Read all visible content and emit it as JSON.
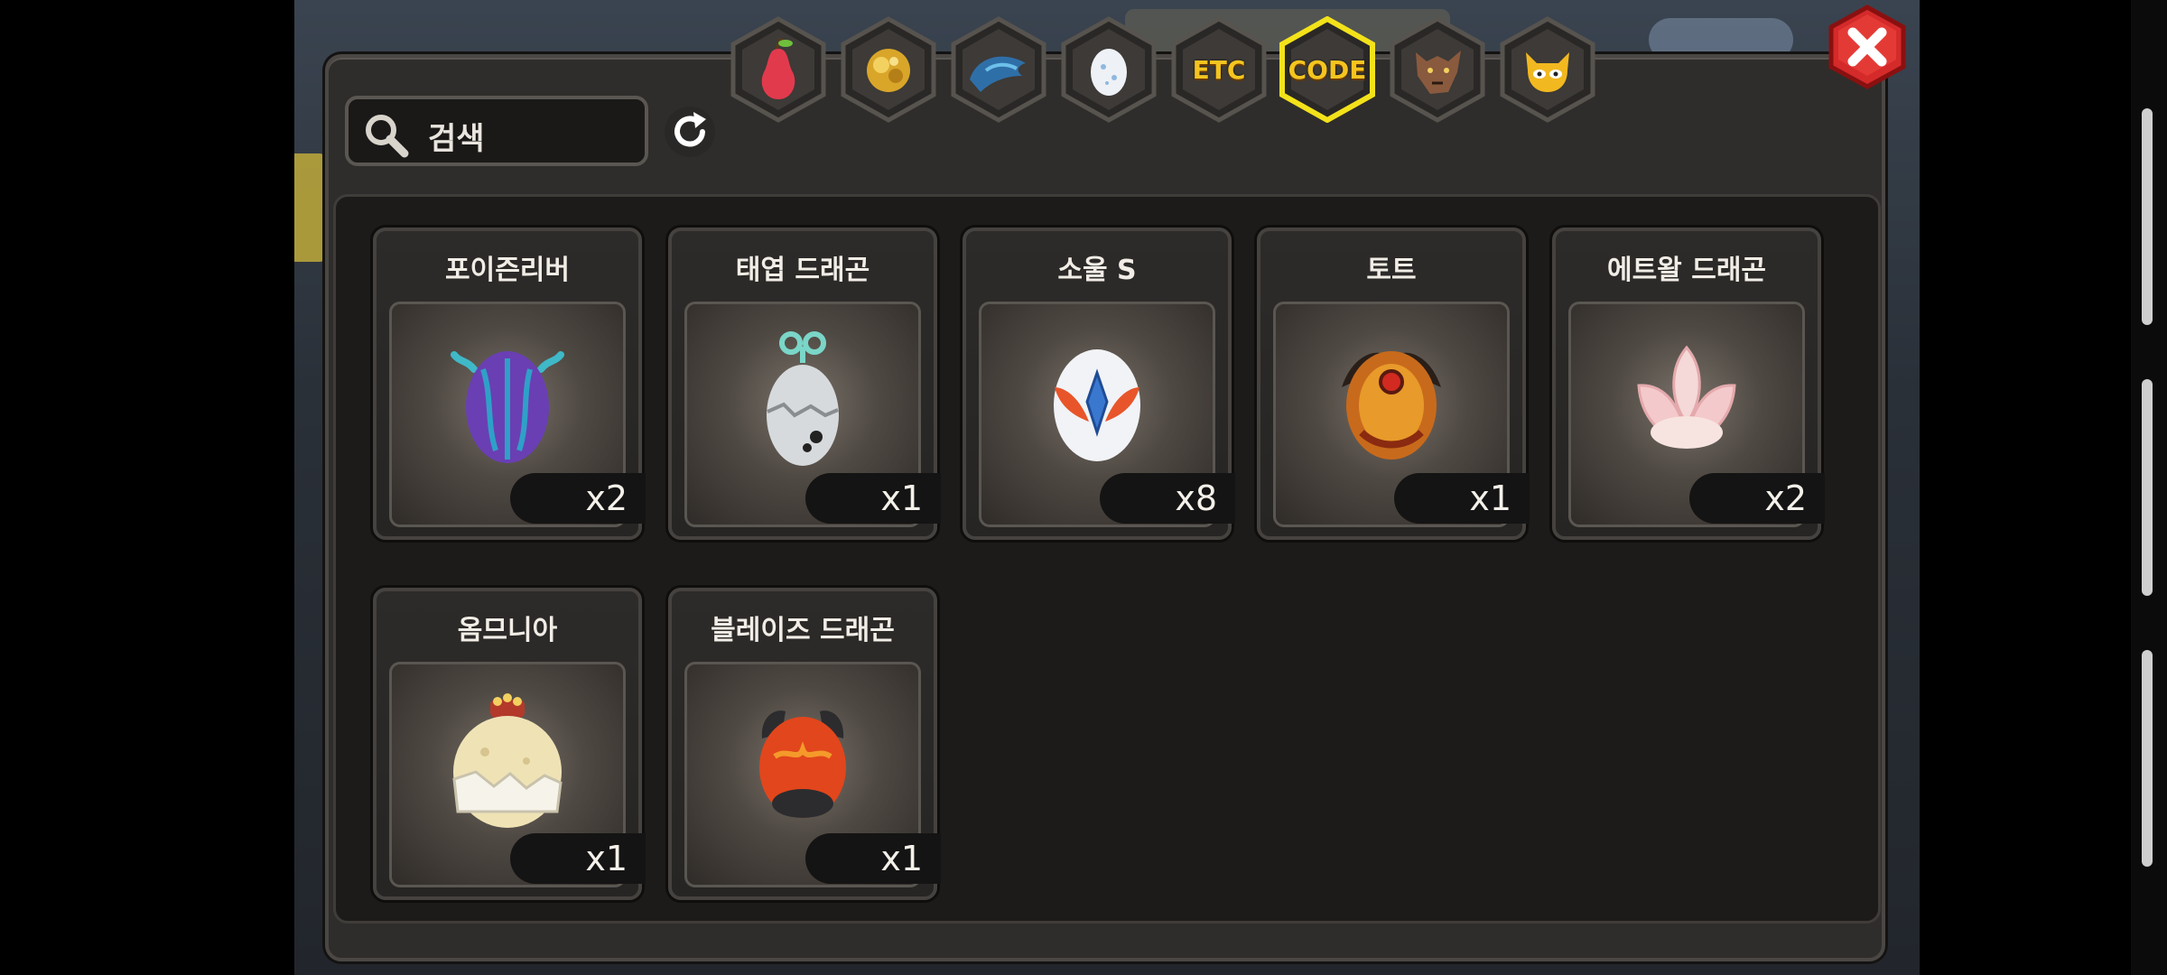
{
  "search": {
    "placeholder": "검색"
  },
  "tabs": [
    {
      "id": "fruit",
      "icon": "pear-fruit-icon",
      "selected": false
    },
    {
      "id": "gold",
      "icon": "gold-nugget-icon",
      "selected": false
    },
    {
      "id": "blue",
      "icon": "blue-dragon-icon",
      "selected": false
    },
    {
      "id": "egg",
      "icon": "egg-icon",
      "selected": false
    },
    {
      "id": "etc",
      "label": "ETC",
      "selected": false
    },
    {
      "id": "code",
      "label": "CODE",
      "selected": true
    },
    {
      "id": "wolf",
      "icon": "wolf-head-icon",
      "selected": false
    },
    {
      "id": "monster",
      "icon": "horned-monster-icon",
      "selected": false
    }
  ],
  "items": [
    {
      "name": "포이즌리버",
      "qty": "x2",
      "icon": "purple-horned-egg-icon"
    },
    {
      "name": "태엽 드래곤",
      "qty": "x1",
      "icon": "windup-key-egg-icon"
    },
    {
      "name": "소울 S",
      "qty": "x8",
      "icon": "winged-crystal-egg-icon"
    },
    {
      "name": "토트",
      "qty": "x1",
      "icon": "golden-horned-egg-icon"
    },
    {
      "name": "에트왈 드래곤",
      "qty": "x2",
      "icon": "lotus-egg-icon"
    },
    {
      "name": "옴므니아",
      "qty": "x1",
      "icon": "crowned-cream-egg-icon"
    },
    {
      "name": "블레이즈 드래곤",
      "qty": "x1",
      "icon": "flame-horned-egg-icon"
    }
  ],
  "colors": {
    "selected_tab_border": "#f3e21a",
    "tab_gold_text": "#f4c41f",
    "close_red": "#d42a2a"
  }
}
